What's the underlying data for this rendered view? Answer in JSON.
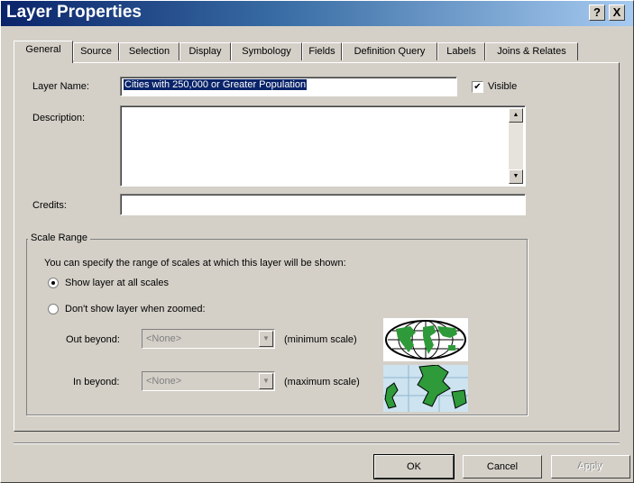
{
  "window": {
    "title": "Layer Properties",
    "help_label": "?",
    "close_label": "X"
  },
  "tabs": [
    {
      "label": "General",
      "active": true
    },
    {
      "label": "Source"
    },
    {
      "label": "Selection"
    },
    {
      "label": "Display"
    },
    {
      "label": "Symbology"
    },
    {
      "label": "Fields"
    },
    {
      "label": "Definition Query"
    },
    {
      "label": "Labels"
    },
    {
      "label": "Joins & Relates"
    }
  ],
  "general": {
    "layer_name_label": "Layer Name:",
    "layer_name_value": "Cities with 250,000 or Greater Population",
    "visible_label": "Visible",
    "visible_checked": true,
    "description_label": "Description:",
    "description_value": "",
    "credits_label": "Credits:",
    "credits_value": ""
  },
  "scale_range": {
    "legend": "Scale Range",
    "intro": "You can specify the range of scales at which this layer will be shown:",
    "option_all": "Show layer at all scales",
    "option_zoomed": "Don't show layer when zoomed:",
    "selected_option": "all",
    "out_beyond_label": "Out beyond:",
    "out_beyond_value": "<None>",
    "min_scale_label": "(minimum scale)",
    "in_beyond_label": "In beyond:",
    "in_beyond_value": "<None>",
    "max_scale_label": "(maximum scale)",
    "globe_icon": "globe-icon",
    "map_icon": "zoomed-map-icon"
  },
  "buttons": {
    "ok": "OK",
    "cancel": "Cancel",
    "apply": "Apply"
  },
  "colors": {
    "title_bar_start": "#0a246a",
    "selection": "#0a246a",
    "land": "#2e9a3a"
  }
}
